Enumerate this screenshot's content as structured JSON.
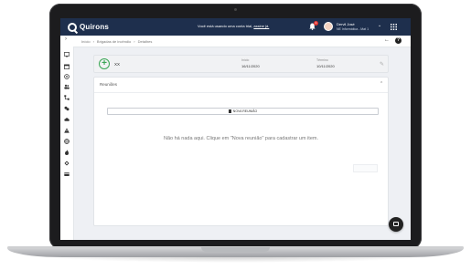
{
  "app": {
    "logo_text": "Quirons",
    "trial_text": "Você está usando uma conta trial,",
    "trial_link": "assine já."
  },
  "user": {
    "name": "Dervil José",
    "org": "NE Informática - Mat 1",
    "notification_count": "1"
  },
  "breadcrumb": {
    "items": [
      "Início",
      "Brigadas de incêndio",
      "Detalhes"
    ]
  },
  "header_card": {
    "title": "XX",
    "start_label": "Início",
    "start_value": "16/11/2020",
    "end_label": "Término",
    "end_value": "10/11/2020"
  },
  "panel": {
    "title": "Reuniões",
    "new_button_label": "NOVA REUNIÃO",
    "empty_message": "Não há nada aqui. Clique em \"Nova reunião\" para cadastrar um item."
  },
  "colors": {
    "topbar": "#1e2f4d",
    "accent_green": "#3aa655",
    "badge_red": "#e53935"
  },
  "sidebar": {
    "icons": [
      "dashboard-icon",
      "calendar-icon",
      "settings-icon",
      "users-icon",
      "tree-icon",
      "group-icon",
      "cloud-icon",
      "warning-icon",
      "globe-icon",
      "fire-icon",
      "extinguisher-icon",
      "card-icon"
    ]
  }
}
